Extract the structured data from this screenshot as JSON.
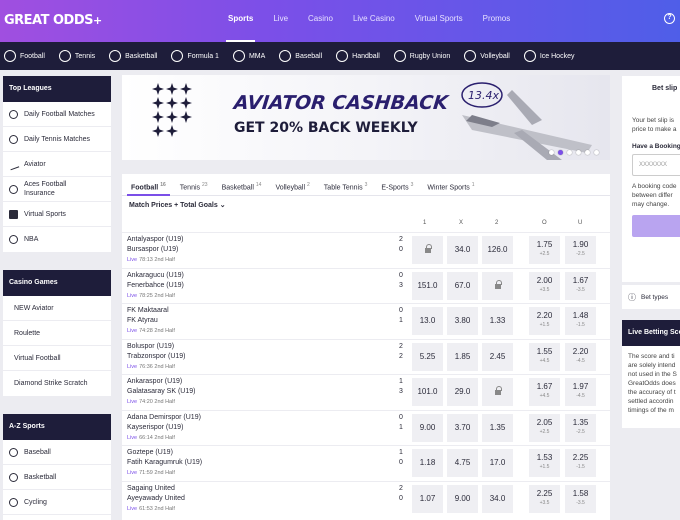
{
  "brand": {
    "logo": "GREAT ODDS",
    "logo_mark": "+"
  },
  "topnav": {
    "items": [
      "Sports",
      "Live",
      "Casino",
      "Live Casino",
      "Virtual Sports",
      "Promos"
    ],
    "active": "Sports"
  },
  "help_icon": "?",
  "sportsbar": [
    "Football",
    "Tennis",
    "Basketball",
    "Formula 1",
    "MMA",
    "Baseball",
    "Handball",
    "Rugby Union",
    "Volleyball",
    "Ice Hockey"
  ],
  "sidebar": {
    "top_leagues": {
      "title": "Top Leagues",
      "items": [
        "Daily Football Matches",
        "Daily Tennis Matches",
        "Aviator",
        "Aces Football Insurance",
        "Virtual Sports",
        "NBA"
      ]
    },
    "casino_games": {
      "title": "Casino Games",
      "items": [
        "NEW Aviator",
        "Roulette",
        "Virtual Football",
        "Diamond Strike Scratch"
      ]
    },
    "az_sports": {
      "title": "A-Z Sports",
      "items": [
        "Baseball",
        "Basketball",
        "Cycling"
      ]
    }
  },
  "banner": {
    "line1": "AVIATOR CASHBACK",
    "line2": "GET 20% BACK WEEKLY",
    "multiplier": "13.4x",
    "slides": 6,
    "active_slide": 1
  },
  "markets": {
    "tabs": [
      {
        "label": "Football",
        "count": "16"
      },
      {
        "label": "Tennis",
        "count": "23"
      },
      {
        "label": "Basketball",
        "count": "14"
      },
      {
        "label": "Volleyball",
        "count": "2"
      },
      {
        "label": "Table Tennis",
        "count": "3"
      },
      {
        "label": "E-Sports",
        "count": "3"
      },
      {
        "label": "Winter Sports",
        "count": "1"
      }
    ],
    "filter": "Match Prices + Total Goals",
    "columns": [
      "1",
      "X",
      "2",
      "O",
      "U"
    ],
    "rows": [
      {
        "team1": "Antalyaspor (U19)",
        "team2": "Bursaspor (U19)",
        "score1": "2",
        "score2": "0",
        "status": "Live",
        "time": "78:13 2nd Half",
        "odds": [
          "lock",
          "34.0",
          "126.0"
        ],
        "over": "1.75",
        "over_line": "+2.5",
        "under": "1.90",
        "under_line": "-2.5"
      },
      {
        "team1": "Ankaragucu (U19)",
        "team2": "Fenerbahce (U19)",
        "score1": "0",
        "score2": "3",
        "status": "Live",
        "time": "78:25 2nd Half",
        "odds": [
          "151.0",
          "67.0",
          "lock"
        ],
        "over": "2.00",
        "over_line": "+3.5",
        "under": "1.67",
        "under_line": "-3.5"
      },
      {
        "team1": "FK Maktaaral",
        "team2": "FK Atyrau",
        "score1": "0",
        "score2": "1",
        "status": "Live",
        "time": "74:28 2nd Half",
        "odds": [
          "13.0",
          "3.80",
          "1.33"
        ],
        "over": "2.20",
        "over_line": "+1.5",
        "under": "1.48",
        "under_line": "-1.5"
      },
      {
        "team1": "Boluspor (U19)",
        "team2": "Trabzonspor (U19)",
        "score1": "2",
        "score2": "2",
        "status": "Live",
        "time": "76:36 2nd Half",
        "odds": [
          "5.25",
          "1.85",
          "2.45"
        ],
        "over": "1.55",
        "over_line": "+4.5",
        "under": "2.20",
        "under_line": "-4.5"
      },
      {
        "team1": "Ankaraspor (U19)",
        "team2": "Galatasaray SK (U19)",
        "score1": "1",
        "score2": "3",
        "status": "Live",
        "time": "74:20 2nd Half",
        "odds": [
          "101.0",
          "29.0",
          "lock"
        ],
        "over": "1.67",
        "over_line": "+4.5",
        "under": "1.97",
        "under_line": "-4.5"
      },
      {
        "team1": "Adana Demirspor (U19)",
        "team2": "Kayserispor (U19)",
        "score1": "0",
        "score2": "1",
        "status": "Live",
        "time": "66:14 2nd Half",
        "odds": [
          "9.00",
          "3.70",
          "1.35"
        ],
        "over": "2.05",
        "over_line": "+2.5",
        "under": "1.35",
        "under_line": "-2.5"
      },
      {
        "team1": "Goztepe (U19)",
        "team2": "Fatih Karagumruk (U19)",
        "score1": "1",
        "score2": "0",
        "status": "Live",
        "time": "71:59 2nd Half",
        "odds": [
          "1.18",
          "4.75",
          "17.0"
        ],
        "over": "1.53",
        "over_line": "+1.5",
        "under": "2.25",
        "under_line": "-1.5"
      },
      {
        "team1": "Sagaing United",
        "team2": "Ayeyawady United",
        "score1": "2",
        "score2": "0",
        "status": "Live",
        "time": "61:53 2nd Half",
        "odds": [
          "1.07",
          "9.00",
          "34.0"
        ],
        "over": "2.25",
        "over_line": "+3.5",
        "under": "1.58",
        "under_line": "-3.5"
      }
    ]
  },
  "betslip": {
    "title": "Bet slip",
    "text1": "Your bet slip is",
    "text2": "price to make a",
    "booking_title": "Have a Booking",
    "input_placeholder": "XXXXXXX",
    "booking_text1": "A booking code",
    "booking_text2": "between differ",
    "booking_text3": "may change.",
    "bet_types": "Bet types"
  },
  "live_score": {
    "title": "Live Betting Sco",
    "lines": [
      "The score and ti",
      "are solely intend",
      "not used in the S",
      "GreatOdds does",
      "the accuracy of t",
      "settled accordin",
      "timings of the m"
    ]
  }
}
